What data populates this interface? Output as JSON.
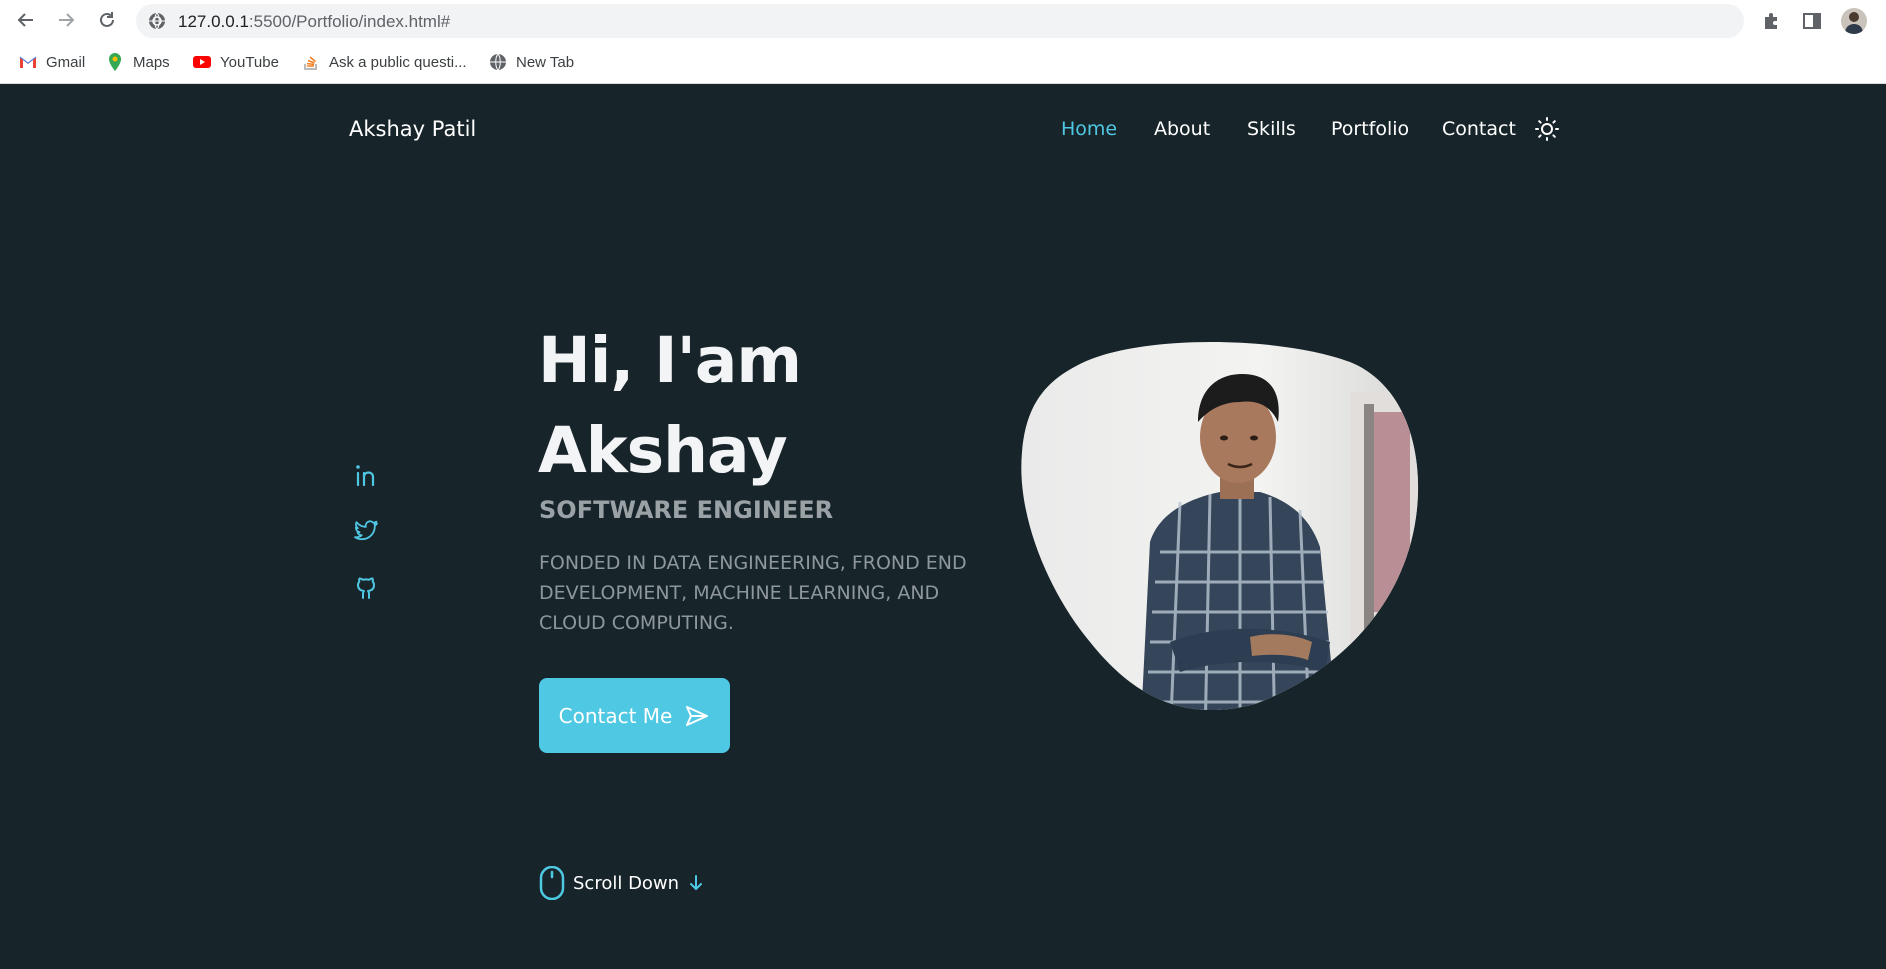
{
  "browser": {
    "url_host": "127.0.0.1",
    "url_rest": ":5500/Portfolio/index.html#",
    "bookmarks": [
      {
        "label": "Gmail",
        "icon": "gmail-icon"
      },
      {
        "label": "Maps",
        "icon": "maps-icon"
      },
      {
        "label": "YouTube",
        "icon": "youtube-icon"
      },
      {
        "label": "Ask a public questi...",
        "icon": "stackoverflow-icon"
      },
      {
        "label": "New Tab",
        "icon": "globe-icon"
      }
    ]
  },
  "header": {
    "brand": "Akshay Patil",
    "nav": [
      {
        "label": "Home",
        "active": true
      },
      {
        "label": "About",
        "active": false
      },
      {
        "label": "Skills",
        "active": false
      },
      {
        "label": "Portfolio",
        "active": false
      },
      {
        "label": "Contact",
        "active": false
      }
    ]
  },
  "hero": {
    "greeting": "Hi, I'am",
    "name": "Akshay",
    "subtitle": "SOFTWARE ENGINEER",
    "description": "FONDED IN DATA ENGINEERING, FROND END DEVELOPMENT, MACHINE LEARNING, AND CLOUD COMPUTING.",
    "cta": "Contact Me",
    "scroll": "Scroll Down"
  },
  "socials": [
    "linkedin-icon",
    "twitter-icon",
    "github-icon"
  ],
  "colors": {
    "background": "#17242a",
    "accent": "#4fc8e3",
    "text": "#f2f4f5",
    "muted": "#8e979b"
  }
}
